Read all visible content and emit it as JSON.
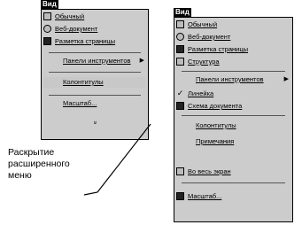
{
  "left_menu": {
    "header": "Вид",
    "items": [
      {
        "icon": "page-icon",
        "label": "Обычный"
      },
      {
        "icon": "web-icon",
        "label": "Веб-документ"
      },
      {
        "icon": "layout-icon",
        "label": "Разметка страницы"
      },
      {
        "icon": "",
        "label": "Панели инструментов",
        "submenu": true
      },
      {
        "icon": "",
        "label": "Колонтитулы"
      },
      {
        "icon": "",
        "label": "Масштаб..."
      }
    ]
  },
  "right_menu": {
    "header": "Вид",
    "items": [
      {
        "icon": "page-icon",
        "label": "Обычный"
      },
      {
        "icon": "web-icon",
        "label": "Веб-документ"
      },
      {
        "icon": "layout-icon",
        "label": "Разметка страницы"
      },
      {
        "icon": "structure-icon",
        "label": "Структура"
      },
      {
        "icon": "",
        "label": "Панели инструментов",
        "submenu": true
      },
      {
        "icon": "check-icon",
        "label": "Линейка"
      },
      {
        "icon": "map-icon",
        "label": "Схема документа"
      },
      {
        "icon": "",
        "label": "Колонтитулы"
      },
      {
        "icon": "",
        "label": "Примечания"
      },
      {
        "icon": "fullscreen-icon",
        "label": "Во весь экран"
      },
      {
        "icon": "zoom-icon",
        "label": "Масштаб..."
      }
    ]
  },
  "caption": {
    "line1": "Раскрытие",
    "line2": "расширенного",
    "line3": "меню"
  },
  "expand_chevron": "»"
}
